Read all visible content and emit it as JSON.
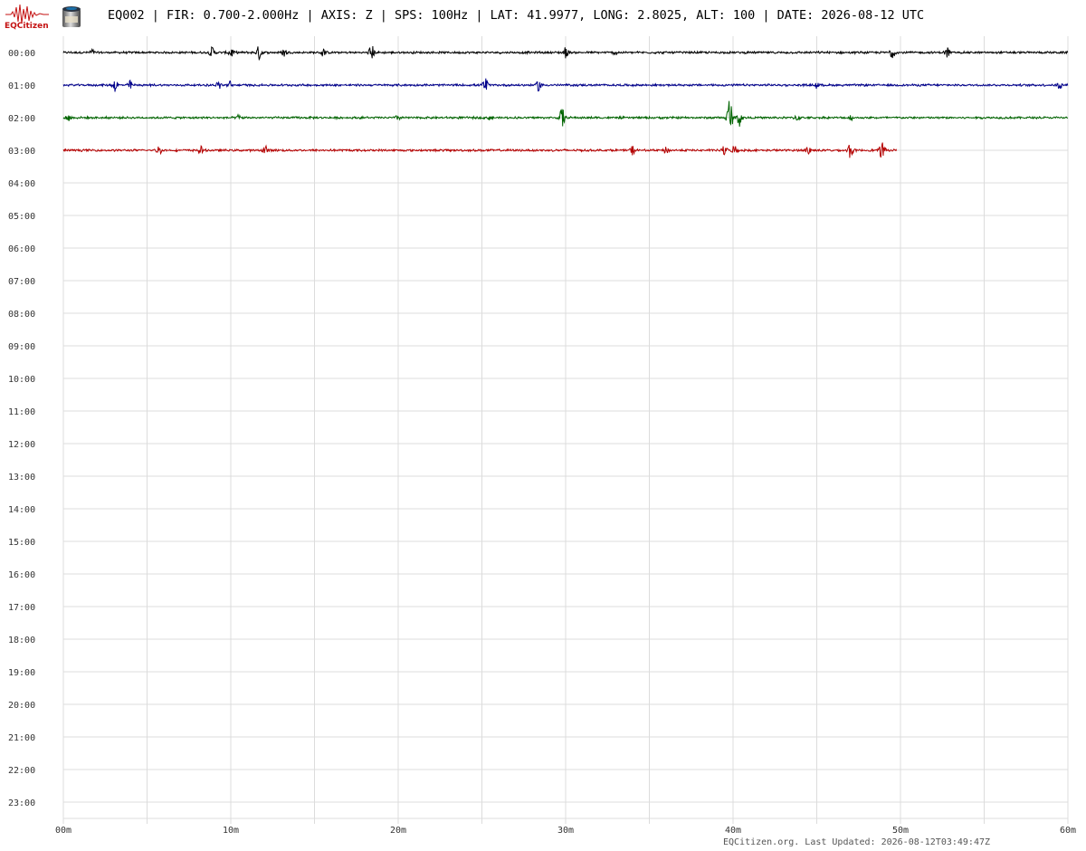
{
  "header": {
    "logo_text": "EQCitizen",
    "title": "EQ002 | FIR: 0.700-2.000Hz | AXIS: Z | SPS: 100Hz | LAT: 41.9977, LONG: 2.8025, ALT: 100 | DATE: 2026-08-12 UTC"
  },
  "footer": {
    "text": "EQCitizen.org. Last Updated: 2026-08-12T03:49:47Z"
  },
  "colors": {
    "grid": "#dcdcdc",
    "trace_cycle": [
      "#000000",
      "#00008b",
      "#006400",
      "#b40000"
    ],
    "logo": "#c41212"
  },
  "chart_data": {
    "type": "line",
    "title": "",
    "xlabel": "",
    "ylabel": "",
    "x_unit": "minutes",
    "xlim": [
      0,
      60
    ],
    "x_ticks": [
      0,
      10,
      20,
      30,
      40,
      50,
      60
    ],
    "x_tick_labels": [
      "00m",
      "10m",
      "20m",
      "30m",
      "40m",
      "50m",
      "60m"
    ],
    "y_tick_labels": [
      "00:00",
      "01:00",
      "02:00",
      "03:00",
      "04:00",
      "05:00",
      "06:00",
      "07:00",
      "08:00",
      "09:00",
      "10:00",
      "11:00",
      "12:00",
      "13:00",
      "14:00",
      "15:00",
      "16:00",
      "17:00",
      "18:00",
      "19:00",
      "20:00",
      "21:00",
      "22:00",
      "23:00"
    ],
    "grid": true,
    "series": [
      {
        "row": "00:00",
        "color": "#000000",
        "x_end_min": 60,
        "bursts": [
          {
            "t": 1.7,
            "amp": 0.18
          },
          {
            "t": 8.9,
            "amp": 0.3
          },
          {
            "t": 10.0,
            "amp": 0.32
          },
          {
            "t": 11.7,
            "amp": 0.42
          },
          {
            "t": 13.2,
            "amp": 0.22
          },
          {
            "t": 15.5,
            "amp": 0.22
          },
          {
            "t": 18.4,
            "amp": 0.45
          },
          {
            "t": 30.0,
            "amp": 0.3
          },
          {
            "t": 33.0,
            "amp": 0.15
          },
          {
            "t": 49.5,
            "amp": 0.32
          },
          {
            "t": 52.8,
            "amp": 0.3
          }
        ]
      },
      {
        "row": "01:00",
        "color": "#00008b",
        "x_end_min": 60,
        "bursts": [
          {
            "t": 3.1,
            "amp": 0.35
          },
          {
            "t": 4.0,
            "amp": 0.22
          },
          {
            "t": 9.3,
            "amp": 0.2
          },
          {
            "t": 10.0,
            "amp": 0.22
          },
          {
            "t": 25.2,
            "amp": 0.45
          },
          {
            "t": 28.4,
            "amp": 0.32
          },
          {
            "t": 45.0,
            "amp": 0.15
          },
          {
            "t": 59.5,
            "amp": 0.2
          }
        ]
      },
      {
        "row": "02:00",
        "color": "#006400",
        "x_end_min": 60,
        "bursts": [
          {
            "t": 0.3,
            "amp": 0.2
          },
          {
            "t": 10.5,
            "amp": 0.18
          },
          {
            "t": 20.0,
            "amp": 0.12
          },
          {
            "t": 25.5,
            "amp": 0.12
          },
          {
            "t": 29.8,
            "amp": 0.6
          },
          {
            "t": 39.8,
            "amp": 1.3
          },
          {
            "t": 40.4,
            "amp": 0.45
          },
          {
            "t": 43.8,
            "amp": 0.2
          },
          {
            "t": 47.0,
            "amp": 0.12
          }
        ]
      },
      {
        "row": "03:00",
        "color": "#b40000",
        "x_end_min": 49.8,
        "bursts": [
          {
            "t": 5.7,
            "amp": 0.25
          },
          {
            "t": 8.2,
            "amp": 0.2
          },
          {
            "t": 12.1,
            "amp": 0.3
          },
          {
            "t": 34.0,
            "amp": 0.25
          },
          {
            "t": 36.0,
            "amp": 0.18
          },
          {
            "t": 39.5,
            "amp": 0.25
          },
          {
            "t": 40.1,
            "amp": 0.3
          },
          {
            "t": 44.5,
            "amp": 0.25
          },
          {
            "t": 47.0,
            "amp": 0.45
          },
          {
            "t": 48.9,
            "amp": 0.5
          }
        ]
      }
    ]
  }
}
